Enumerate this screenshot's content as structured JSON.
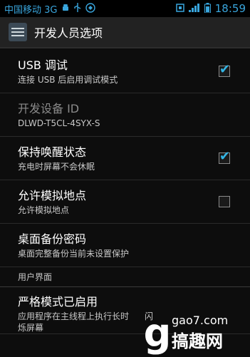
{
  "statusbar": {
    "carrier": "中国移动 3G",
    "time": "18:59"
  },
  "actionbar": {
    "title": "开发人员选项"
  },
  "items": [
    {
      "title": "USB 调试",
      "summary": "连接 USB 后启用调试模式",
      "checked": true
    },
    {
      "title": "开发设备 ID",
      "summary": "DLWD-T5CL-4SYX-S"
    },
    {
      "title": "保持唤醒状态",
      "summary": "充电时屏幕不会休眠",
      "checked": true
    },
    {
      "title": "允许模拟地点",
      "summary": "允许模拟地点",
      "checked": false
    },
    {
      "title": "桌面备份密码",
      "summary": "桌面完整备份当前未设置保护"
    }
  ],
  "section_header": "用户界面",
  "strict_mode": {
    "title": "严格模式已启用",
    "summary_line1": "应用程序在主线程上执行长时",
    "summary_line1_end": "闪",
    "summary_line2": "烁屏幕"
  },
  "watermark": {
    "url": "gao7.com",
    "brand": "搞趣网",
    "mark": "g"
  },
  "colors": {
    "accent": "#33b5e5",
    "status": "#39a5dc",
    "background": "#0d0d0d"
  }
}
